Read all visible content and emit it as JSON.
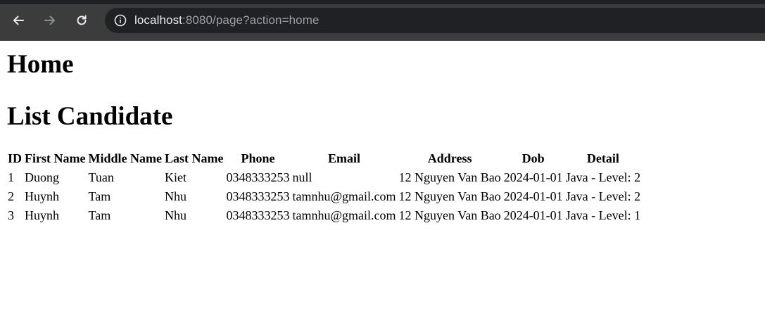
{
  "browser": {
    "url_host": "localhost",
    "url_rest": ":8080/page?action=home"
  },
  "page": {
    "heading": "Home",
    "subheading": "List Candidate"
  },
  "table": {
    "headers": [
      "ID",
      "First Name",
      "Middle Name",
      "Last Name",
      "Phone",
      "Email",
      "Address",
      "Dob",
      "Detail"
    ],
    "rows": [
      [
        "1",
        "Duong",
        "Tuan",
        "Kiet",
        "0348333253",
        "null",
        "12 Nguyen Van Bao",
        "2024-01-01",
        "Java - Level: 2"
      ],
      [
        "2",
        "Huynh",
        "Tam",
        "Nhu",
        "0348333253",
        "tamnhu@gmail.com",
        "12 Nguyen Van Bao",
        "2024-01-01",
        "Java - Level: 2"
      ],
      [
        "3",
        "Huynh",
        "Tam",
        "Nhu",
        "0348333253",
        "tamnhu@gmail.com",
        "12 Nguyen Van Bao",
        "2024-01-01",
        "Java - Level: 1"
      ]
    ]
  }
}
